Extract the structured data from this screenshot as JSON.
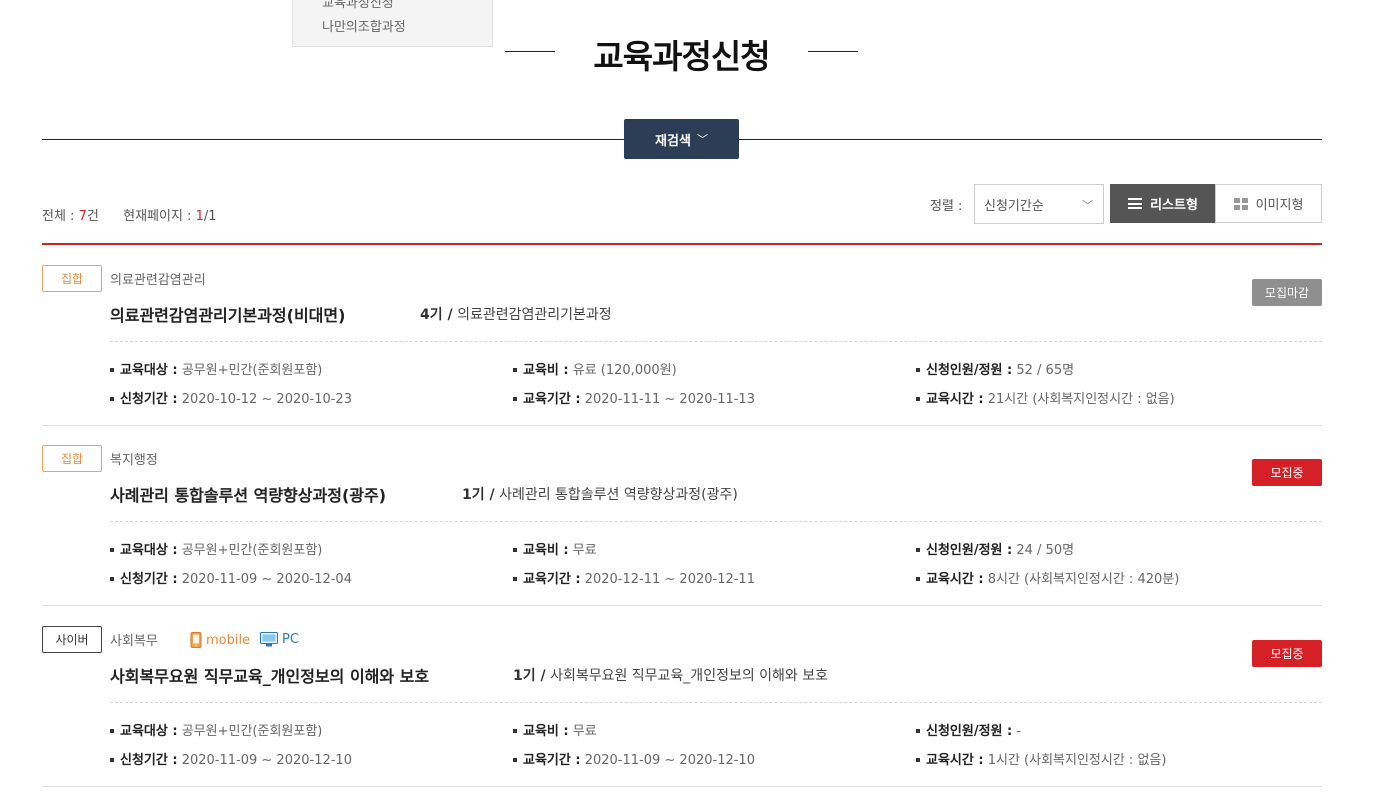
{
  "dropdown": {
    "items": [
      "교육과정신청",
      "나만의조합과정"
    ]
  },
  "page": {
    "title": "교육과정신청"
  },
  "search": {
    "research_label": "재검색"
  },
  "summary": {
    "total_label": "전체 : ",
    "total_count": "7",
    "total_unit": "건",
    "page_label": "현재페이지 : ",
    "current_page": "1",
    "total_pages": "/1"
  },
  "sort": {
    "label": "정렬 :",
    "selected": "신청기간순"
  },
  "view": {
    "list_label": "리스트형",
    "image_label": "이미지형"
  },
  "courses": [
    {
      "type": "집합",
      "category": "의료관련감염관리",
      "title": "의료관련감염관리기본과정(비대면)",
      "round": "4기 /",
      "round_desc": "의료관련감염관리기본과정",
      "status": "모집마감",
      "info": {
        "target_key": "교육대상 :",
        "target": "공무원+민간(준회원포함)",
        "fee_key": "교육비 :",
        "fee": "유료 (120,000원)",
        "quota_key": "신청인원/정원 :",
        "quota": "52 / 65명",
        "apply_key": "신청기간 :",
        "apply_period": "2020-10-12 ~ 2020-10-23",
        "edu_key": "교육기간 :",
        "edu_period": "2020-11-11 ~ 2020-11-13",
        "hours_key": "교육시간 :",
        "hours": "21시간 (사회복지인정시간 : 없음)"
      }
    },
    {
      "type": "집합",
      "category": "복지행정",
      "title": "사례관리 통합솔루션 역량향상과정(광주)",
      "round": "1기 /",
      "round_desc": "사례관리 통합솔루션 역량향상과정(광주)",
      "status": "모집중",
      "info": {
        "target_key": "교육대상 :",
        "target": "공무원+민간(준회원포함)",
        "fee_key": "교육비 :",
        "fee": "무료",
        "quota_key": "신청인원/정원 :",
        "quota": "24 / 50명",
        "apply_key": "신청기간 :",
        "apply_period": "2020-11-09 ~ 2020-12-04",
        "edu_key": "교육기간 :",
        "edu_period": "2020-12-11 ~ 2020-12-11",
        "hours_key": "교육시간 :",
        "hours": "8시간 (사회복지인정시간 : 420분)"
      }
    },
    {
      "type": "사이버",
      "category": "사회복무",
      "device_mobile": "mobile",
      "device_pc": "PC",
      "title": "사회복무요원 직무교육_개인정보의 이해와 보호",
      "round": "1기 /",
      "round_desc": "사회복무요원 직무교육_개인정보의 이해와 보호",
      "status": "모집중",
      "info": {
        "target_key": "교육대상 :",
        "target": "공무원+민간(준회원포함)",
        "fee_key": "교육비 :",
        "fee": "무료",
        "quota_key": "신청인원/정원 :",
        "quota": "-",
        "apply_key": "신청기간 :",
        "apply_period": "2020-11-09 ~ 2020-12-10",
        "edu_key": "교육기간 :",
        "edu_period": "2020-11-09 ~ 2020-12-10",
        "hours_key": "교육시간 :",
        "hours": "1시간 (사회복지인정시간 : 없음)"
      }
    }
  ],
  "colors": {
    "accent_red": "#d52027",
    "navy": "#2c3e55",
    "orange": "#e68a3a",
    "pc_blue": "#2a7bbd"
  }
}
